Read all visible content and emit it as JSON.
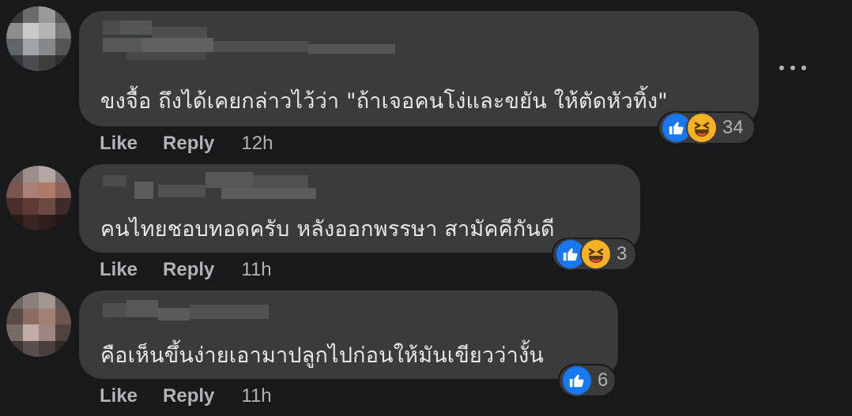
{
  "comments": [
    {
      "text": "ขงจื้อ ถึงได้เคยกล่าวไว้ว่า \"ถ้าเจอคนโง่และขยัน ให้ตัดหัวทิ้ง\"",
      "like_label": "Like",
      "reply_label": "Reply",
      "time": "12h",
      "reactions": [
        "like-icon",
        "haha-icon"
      ],
      "reaction_count": "34"
    },
    {
      "text": "คนไทยชอบทอดครับ หลังออกพรรษา สามัคคีกันดี",
      "like_label": "Like",
      "reply_label": "Reply",
      "time": "11h",
      "reactions": [
        "like-icon",
        "haha-icon"
      ],
      "reaction_count": "3"
    },
    {
      "text": "คือเห็นขึ้นง่ายเอามาปลูกไปก่อนให้มันเขียวว่างั้น",
      "like_label": "Like",
      "reply_label": "Reply",
      "time": "11h",
      "reactions": [
        "like-icon"
      ],
      "reaction_count": "6"
    }
  ],
  "colors": {
    "background": "#18191a",
    "bubble": "#3a3b3c",
    "text": "#e4e6eb",
    "secondary_text": "#b0b3b8",
    "like_blue": "#1877f2",
    "haha_yellow": "#f7b125"
  }
}
